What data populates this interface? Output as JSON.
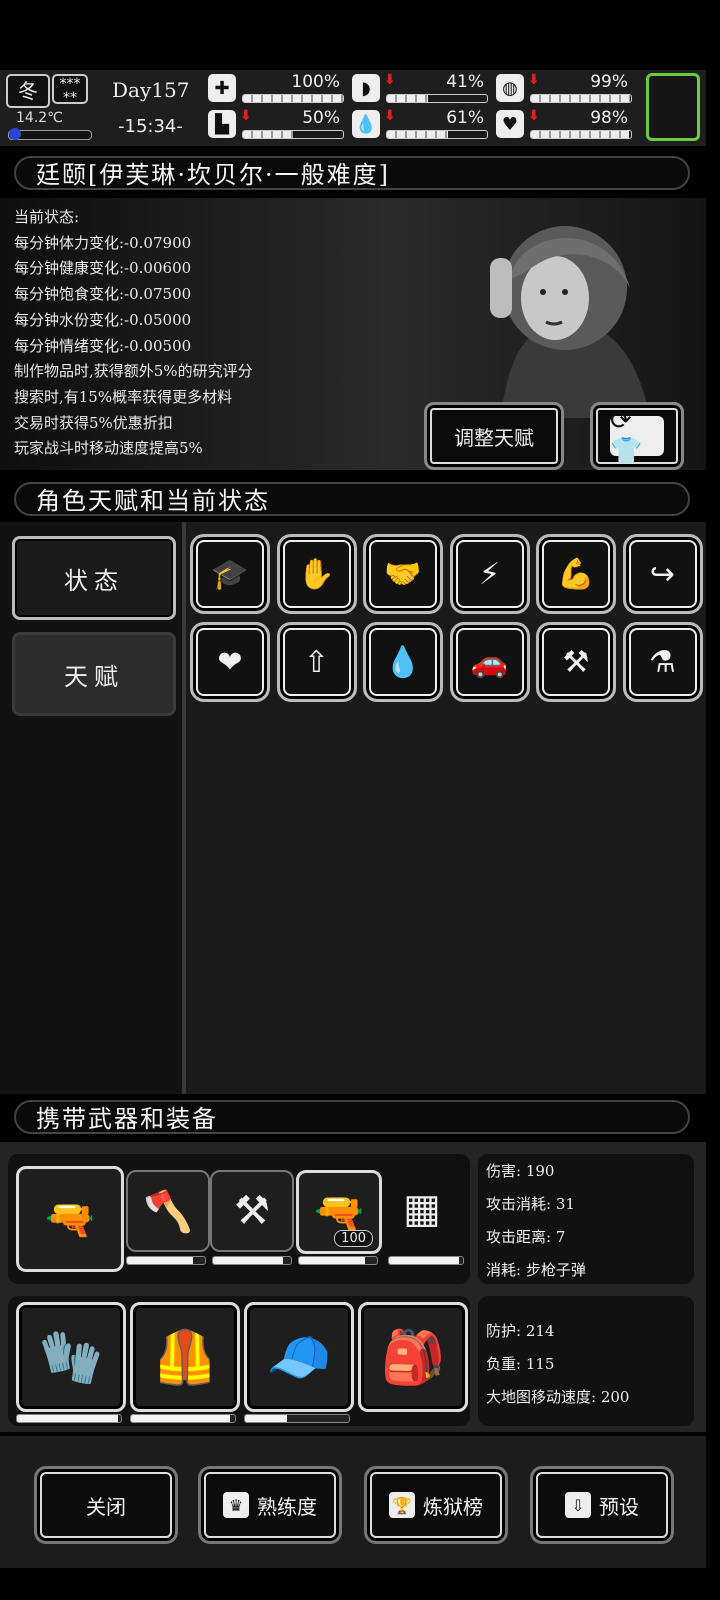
{
  "hud": {
    "season": "冬",
    "weather_icon": "snowflake-icon",
    "temperature": "14.2℃",
    "day": "Day157",
    "time": "-15:34-",
    "stats": [
      {
        "id": "health",
        "icon": "medkit-icon",
        "glyph": "✚",
        "value": "100%",
        "level": 1.0,
        "down": false
      },
      {
        "id": "hunger",
        "icon": "stomach-icon",
        "glyph": "◗",
        "value": "41%",
        "level": 0.41,
        "down": true
      },
      {
        "id": "sanity",
        "icon": "pill-icon",
        "glyph": "◍",
        "value": "99%",
        "level": 0.99,
        "down": true
      },
      {
        "id": "stamina",
        "icon": "boot-icon",
        "glyph": "▙",
        "value": "50%",
        "level": 0.5,
        "down": true
      },
      {
        "id": "thirst",
        "icon": "water-drop-icon",
        "glyph": "💧",
        "value": "61%",
        "level": 0.61,
        "down": true
      },
      {
        "id": "mood",
        "icon": "heart-icon",
        "glyph": "♥",
        "value": "98%",
        "level": 0.98,
        "down": true
      }
    ]
  },
  "character": {
    "title": "廷颐[伊芙琳·坎贝尔·一般难度]",
    "status_lines": [
      "当前状态:",
      "每分钟体力变化:-0.07900",
      "每分钟健康变化:-0.00600",
      "每分钟饱食变化:-0.07500",
      "每分钟水份变化:-0.05000",
      "每分钟情绪变化:-0.00500",
      "制作物品时,获得额外5%的研究评分",
      "搜索时,有15%概率获得更多材料",
      "交易时获得5%优惠折扣",
      "玩家战斗时移动速度提高5%"
    ],
    "adjust_button": "调整天赋",
    "outfit_icon": "outfit-swap-icon"
  },
  "talents": {
    "title": "角色天赋和当前状态",
    "tabs": [
      "状态",
      "天赋"
    ],
    "icons": [
      {
        "name": "graduation-cap-icon",
        "glyph": "🎓"
      },
      {
        "name": "gather-hand-icon",
        "glyph": "✋"
      },
      {
        "name": "handshake-icon",
        "glyph": "🤝"
      },
      {
        "name": "sprint-icon",
        "glyph": "⚡"
      },
      {
        "name": "muscle-icon",
        "glyph": "💪"
      },
      {
        "name": "trade-hook-icon",
        "glyph": "↪"
      },
      {
        "name": "heart-up-icon",
        "glyph": "❤"
      },
      {
        "name": "stomach-up-icon",
        "glyph": "⇧"
      },
      {
        "name": "drop-up-icon",
        "glyph": "💧"
      },
      {
        "name": "car-icon",
        "glyph": "🚗"
      },
      {
        "name": "crossed-axes-icon",
        "glyph": "⚒"
      },
      {
        "name": "flask-icon",
        "glyph": "⚗"
      }
    ]
  },
  "equipment": {
    "title": "携带武器和装备",
    "weapons": [
      {
        "name": "minigun-slot",
        "glyph": "🔫"
      },
      {
        "name": "axe-slot",
        "glyph": "🪓"
      },
      {
        "name": "shovel-slot",
        "glyph": "⚒"
      },
      {
        "name": "rifle-slot",
        "glyph": "🔫",
        "ammo": "100"
      },
      {
        "name": "device-slot",
        "glyph": "▦"
      }
    ],
    "weapon_bars": [
      0.4,
      0.85,
      0.9,
      0.85,
      0.95
    ],
    "weapon_info": [
      "伤害: 190",
      "攻击消耗: 31",
      "攻击距离: 7",
      "消耗: 步枪子弹"
    ],
    "armor": [
      {
        "name": "gauntlets-slot",
        "glyph": "🧤"
      },
      {
        "name": "vest-slot",
        "glyph": "🦺"
      },
      {
        "name": "hat-slot",
        "glyph": "🧢"
      },
      {
        "name": "backpack-slot",
        "glyph": "🎒"
      }
    ],
    "armor_bars": [
      0.97,
      0.95,
      0.4
    ],
    "armor_info": [
      "防护: 214",
      "负重: 115",
      "大地图移动速度: 200"
    ]
  },
  "bottom": {
    "close": "关闭",
    "proficiency": "熟练度",
    "ranking": "炼狱榜",
    "preset": "预设"
  }
}
